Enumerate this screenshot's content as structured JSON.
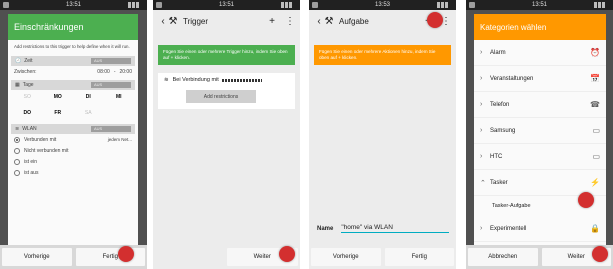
{
  "panel1": {
    "time": "13:51",
    "title": "Einschränkungen",
    "description": "Add restrictions to this trigger to help define when it will run.",
    "zeit": {
      "label": "Zeit",
      "toggle": "AUS",
      "between": "Zwischen:",
      "from": "08:00",
      "sep": "-",
      "to": "20:00"
    },
    "tage": {
      "label": "Tage",
      "toggle": "AUS",
      "days": [
        "SO",
        "MO",
        "DI",
        "MI",
        "DO",
        "FR",
        "SA"
      ]
    },
    "wlan": {
      "label": "WLAN",
      "toggle": "AUS",
      "options": [
        "Verbunden mit",
        "Nicht verbunden mit",
        "ist ein",
        "ist aus"
      ],
      "network": "jedem Net..."
    },
    "buttons": {
      "back": "Vorherige",
      "done": "Fertig"
    }
  },
  "panel2": {
    "time": "13:51",
    "title": "Trigger",
    "banner": "Fügen Sie einen oder mehrere Trigger hinzu, indem Sie oben auf + klicken.",
    "banner_color": "#4caf50",
    "trigger": "Bei Verbindung mit",
    "add_restrictions": "Add restrictions",
    "next": "Weiter"
  },
  "panel3": {
    "time": "13:53",
    "title": "Aufgabe",
    "banner": "Fügen Sie einen oder mehrere Aktionen hinzu, indem Sie oben auf + klicken.",
    "banner_color": "#ff9800",
    "name_label": "Name",
    "name_value": "\"home\" via WLAN",
    "buttons": {
      "back": "Vorherige",
      "done": "Fertig"
    }
  },
  "panel4": {
    "time": "13:51",
    "title": "Kategorien wählen",
    "categories": [
      {
        "label": "Alarm",
        "icon": "alarm-clock-icon",
        "glyph": "⏰"
      },
      {
        "label": "Veranstaltungen",
        "icon": "calendar-icon",
        "glyph": "📅"
      },
      {
        "label": "Telefon",
        "icon": "phone-icon",
        "glyph": "☎"
      },
      {
        "label": "Samsung",
        "icon": "samsung-icon",
        "glyph": "▭"
      },
      {
        "label": "HTC",
        "icon": "htc-icon",
        "glyph": "▭"
      },
      {
        "label": "Tasker",
        "icon": "lightning-icon",
        "glyph": "⚡"
      }
    ],
    "sub_item": "Tasker-Aufgabe",
    "experimental": {
      "label": "Experimentell",
      "icon": "lock-icon",
      "glyph": "🔒"
    },
    "buttons": {
      "cancel": "Abbrechen",
      "next": "Weiter"
    }
  }
}
